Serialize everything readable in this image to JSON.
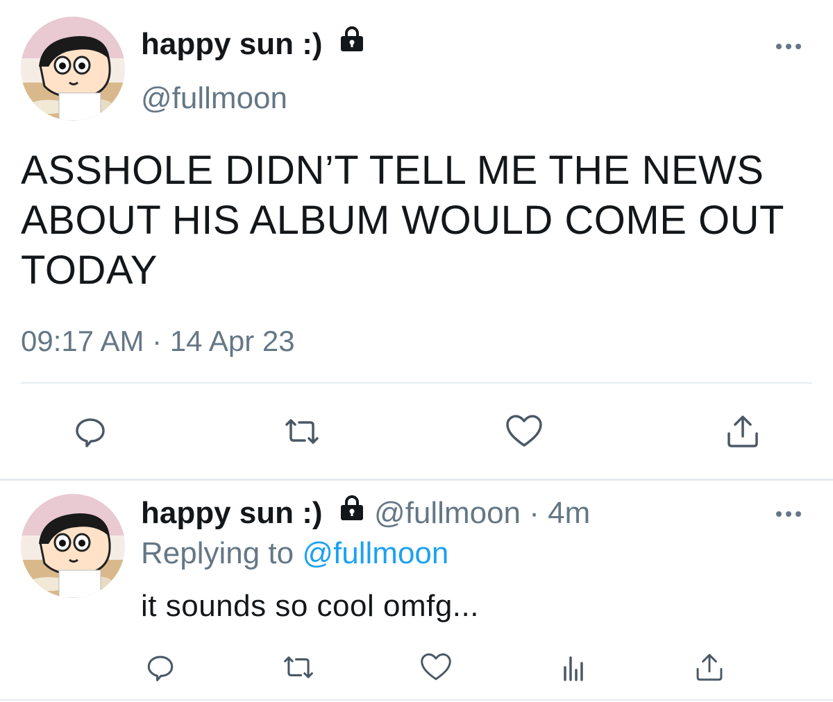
{
  "main_tweet": {
    "display_name": "happy sun :)",
    "handle": "@fullmoon",
    "text": "ASSHOLE DIDN’T TELL ME THE NEWS ABOUT HIS ALBUM WOULD COME OUT TODAY",
    "time": "09:17 AM",
    "separator": "·",
    "date": "14 Apr 23",
    "icons": [
      "lock-icon",
      "more-icon",
      "reply-icon",
      "retweet-icon",
      "like-icon",
      "share-icon"
    ]
  },
  "reply_tweet": {
    "display_name": "happy sun :)",
    "handle": "@fullmoon",
    "separator": "·",
    "age": "4m",
    "replying_prefix": "Replying to",
    "replying_to": "@fullmoon",
    "text": "it sounds so cool omfg...",
    "icons": [
      "lock-icon",
      "more-icon",
      "reply-icon",
      "retweet-icon",
      "like-icon",
      "analytics-icon",
      "share-icon"
    ]
  },
  "colors": {
    "text": "#14171a",
    "secondary": "#657786",
    "link": "#1da1f2",
    "divider": "#e6ecf0"
  }
}
